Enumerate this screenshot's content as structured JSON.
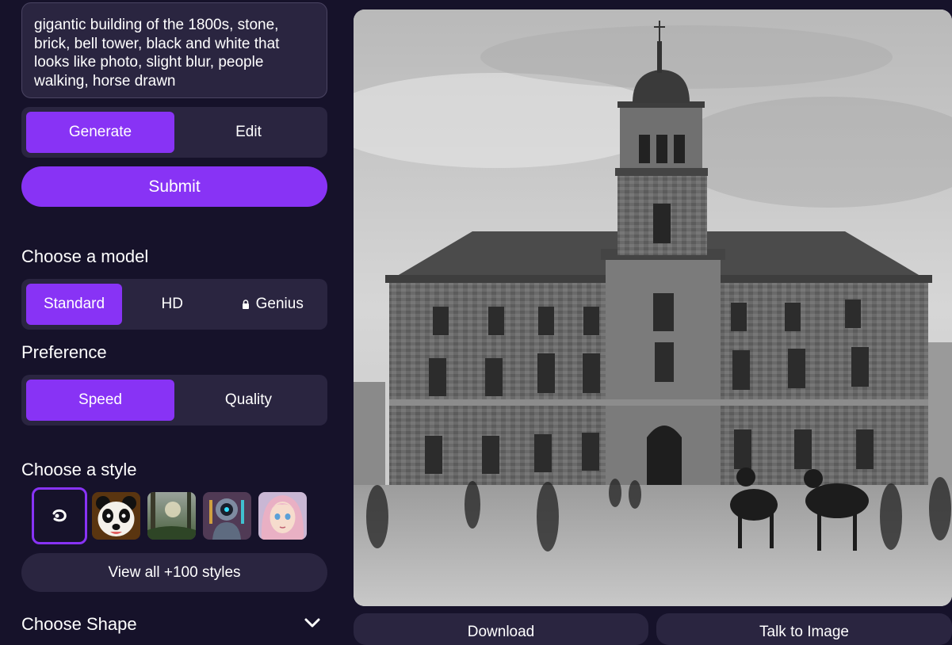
{
  "prompt": {
    "text": "gigantic building of the 1800s, stone, brick, bell tower, black and white that looks like photo, slight blur, people walking, horse drawn"
  },
  "mode": {
    "options": [
      {
        "label": "Generate",
        "active": true
      },
      {
        "label": "Edit",
        "active": false
      }
    ]
  },
  "submit_label": "Submit",
  "model": {
    "heading": "Choose a model",
    "options": [
      {
        "label": "Standard",
        "active": true
      },
      {
        "label": "HD",
        "active": false
      },
      {
        "label": "Genius",
        "active": false,
        "locked": true,
        "icon": "lock-icon"
      }
    ]
  },
  "preference": {
    "heading": "Preference",
    "options": [
      {
        "label": "Speed",
        "active": true
      },
      {
        "label": "Quality",
        "active": false
      }
    ]
  },
  "style": {
    "heading": "Choose a style",
    "thumbnails": [
      "no-style-icon",
      "panda",
      "forest",
      "robot",
      "anime-girl"
    ],
    "view_all_label": "View all +100 styles"
  },
  "shape": {
    "heading": "Choose Shape",
    "icon": "chevron-down-icon"
  },
  "actions": {
    "download_label": "Download",
    "talk_label": "Talk to Image"
  },
  "colors": {
    "accent": "#8833f5",
    "background": "#16122a",
    "panel": "#2a2540"
  }
}
